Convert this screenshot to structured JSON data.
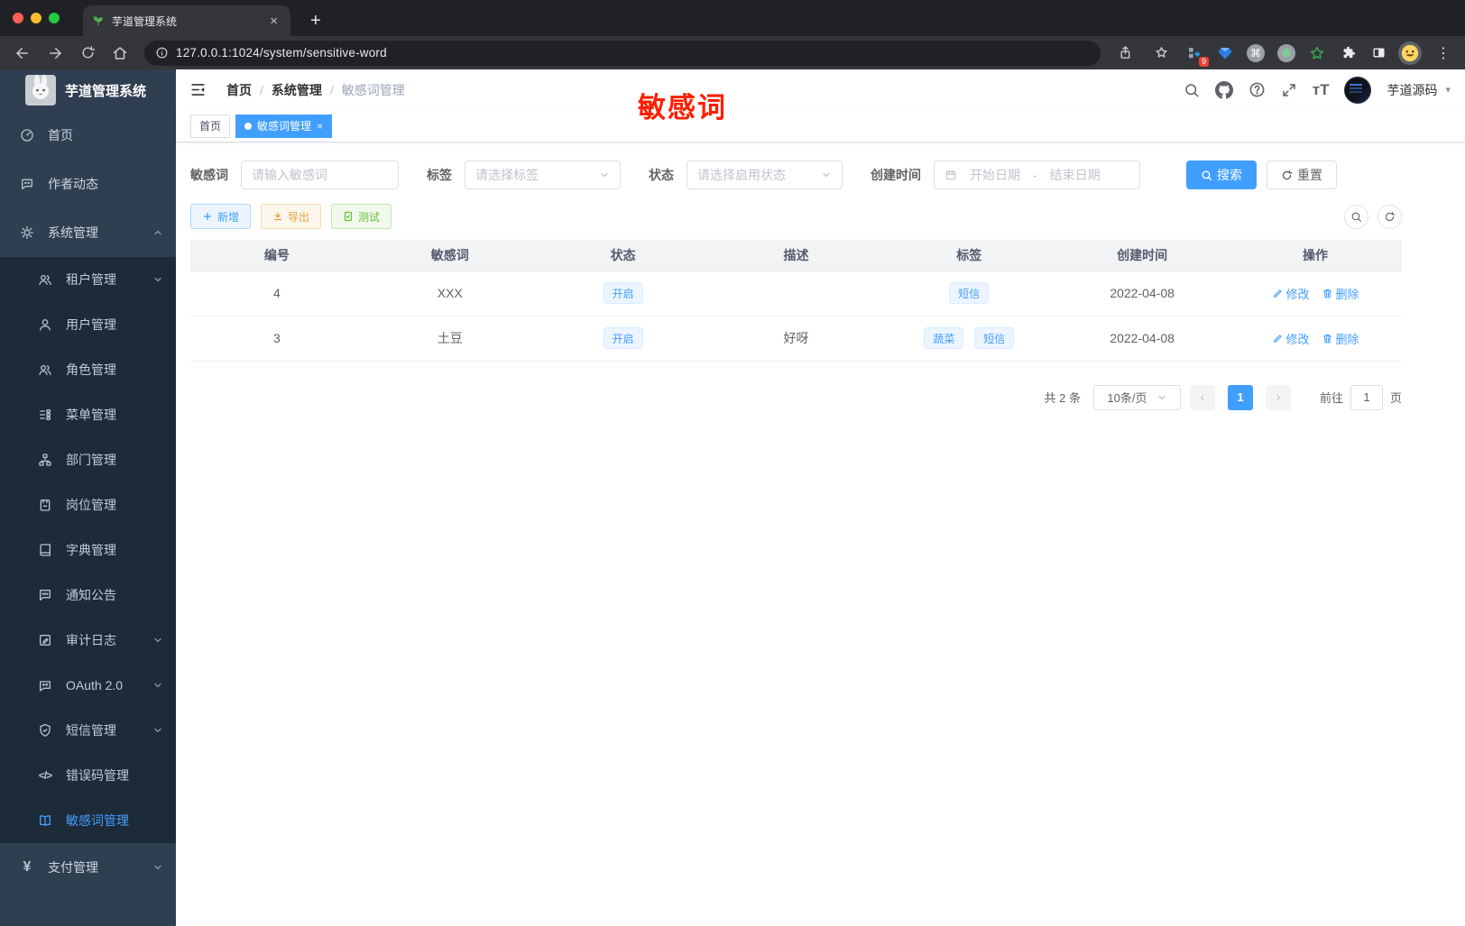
{
  "browser": {
    "tab_title": "芋道管理系统",
    "url": "127.0.0.1:1024/system/sensitive-word",
    "extension_badge": "9"
  },
  "glyphs": {
    "close": "×",
    "new_tab": "+",
    "overflow_menu": "⋮",
    "caret_down": "▾",
    "font_size": "тT",
    "prev": "‹",
    "next": "›",
    "yen": "¥",
    "code": "</>",
    "command": "⌘",
    "breadcrumb_sep": "/",
    "range_sep": "-"
  },
  "sidebar": {
    "title": "芋道管理系统",
    "menu": [
      {
        "icon": "dashboard",
        "label": "首页"
      },
      {
        "icon": "chat",
        "label": "作者动态"
      },
      {
        "icon": "gear",
        "label": "系统管理",
        "expanded": true,
        "children": [
          {
            "icon": "tenant-users",
            "label": "租户管理",
            "has_children": true
          },
          {
            "icon": "user",
            "label": "用户管理"
          },
          {
            "icon": "role-users",
            "label": "角色管理"
          },
          {
            "icon": "menu-tree",
            "label": "菜单管理"
          },
          {
            "icon": "org",
            "label": "部门管理"
          },
          {
            "icon": "post-badge",
            "label": "岗位管理"
          },
          {
            "icon": "dict-book",
            "label": "字典管理"
          },
          {
            "icon": "notice",
            "label": "通知公告"
          },
          {
            "icon": "audit-edit",
            "label": "审计日志",
            "has_children": true
          },
          {
            "icon": "oauth",
            "label": "OAuth 2.0",
            "has_children": true
          },
          {
            "icon": "sms-shield",
            "label": "短信管理",
            "has_children": true
          },
          {
            "icon": "error-code",
            "label": "错误码管理"
          },
          {
            "icon": "open-book",
            "label": "敏感词管理",
            "active": true
          }
        ]
      },
      {
        "icon": "yen",
        "label": "支付管理",
        "has_children": true
      }
    ]
  },
  "header": {
    "breadcrumb": [
      "首页",
      "系统管理",
      "敏感词管理"
    ],
    "username": "芋道源码"
  },
  "annotation": {
    "text": "敏感词",
    "color": "#ff1e00"
  },
  "tags_view": [
    {
      "label": "首页"
    },
    {
      "label": "敏感词管理",
      "active": true,
      "closable": true
    }
  ],
  "filters": {
    "word": {
      "label": "敏感词",
      "placeholder": "请输入敏感词"
    },
    "tag": {
      "label": "标签",
      "placeholder": "请选择标签"
    },
    "status": {
      "label": "状态",
      "placeholder": "请选择启用状态"
    },
    "create_time": {
      "label": "创建时间",
      "start_placeholder": "开始日期",
      "separator": "-",
      "end_placeholder": "结束日期"
    },
    "search_label": "搜索",
    "reset_label": "重置"
  },
  "toolbar": {
    "add_label": "新增",
    "export_label": "导出",
    "test_label": "测试"
  },
  "table": {
    "headers": [
      "编号",
      "敏感词",
      "状态",
      "描述",
      "标签",
      "创建时间",
      "操作"
    ],
    "actions": {
      "edit": "修改",
      "delete": "删除"
    },
    "rows": [
      {
        "id": "4",
        "word": "XXX",
        "status": "开启",
        "description": "",
        "tags": [
          "短信"
        ],
        "create_time": "2022-04-08"
      },
      {
        "id": "3",
        "word": "土豆",
        "status": "开启",
        "description": "好呀",
        "tags": [
          "蔬菜",
          "短信"
        ],
        "create_time": "2022-04-08"
      }
    ]
  },
  "pagination": {
    "total_text": "共 2 条",
    "page_size": "10条/页",
    "current_page": "1",
    "goto_label": "前往",
    "goto_value": "1",
    "page_suffix": "页"
  },
  "colors": {
    "primary": "#409eff",
    "warning": "#e6a23c",
    "success": "#67c23a",
    "sidebar_bg": "#2f3e50",
    "submenu_bg": "#1d2a38",
    "annotation": "#ff1e00"
  }
}
